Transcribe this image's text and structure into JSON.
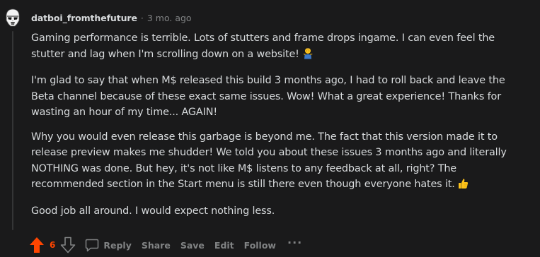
{
  "comment": {
    "author": "datboi_fromthefuture",
    "separator": "·",
    "age": "3 mo. ago",
    "paragraphs": [
      "Gaming performance is terrible. Lots of stutters and frame drops ingame. I can even feel the stutter and lag when I'm scrolling down on a website!",
      "I'm glad to say that when M$ released this build 3 months ago, I had to roll back and leave the Beta channel because of these exact same issues. Wow! What a great experience! Thanks for wasting an hour of my time... AGAIN!",
      "Why you would even release this garbage is beyond me. The fact that this version made it to release preview makes me shudder! We told you about these issues 3 months ago and literally NOTHING was done. But hey, it's not like M$ listens to any feedback at all, right? The recommended section in the Start menu is still there even though everyone hates it.",
      "Good job all around. I would expect nothing less."
    ],
    "emojis": {
      "first": "person-shrugging-emoji",
      "third": "thumbs-up-emoji"
    },
    "score": "6",
    "actions": {
      "reply": "Reply",
      "share": "Share",
      "save": "Save",
      "edit": "Edit",
      "follow": "Follow",
      "more": "···"
    }
  },
  "colors": {
    "background": "#1a1a1b",
    "text": "#d7dadc",
    "muted": "#818384",
    "upvote": "#ff4500"
  }
}
